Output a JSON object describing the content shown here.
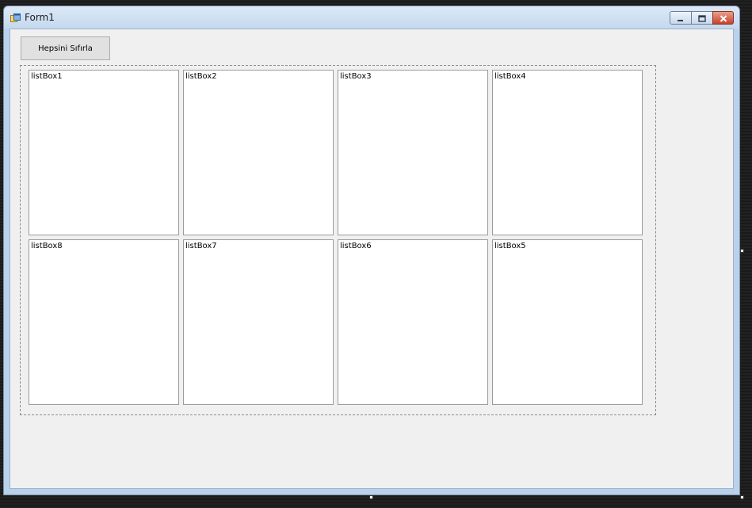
{
  "window": {
    "title": "Form1"
  },
  "toolbar": {
    "reset_label": "Hepsini Sıfırla"
  },
  "listboxes": {
    "row1": [
      "listBox1",
      "listBox2",
      "listBox3",
      "listBox4"
    ],
    "row2": [
      "listBox8",
      "listBox7",
      "listBox6",
      "listBox5"
    ]
  },
  "icons": {
    "app": "form-app-icon",
    "minimize": "minimize-icon",
    "maximize": "maximize-icon",
    "close": "close-icon"
  },
  "colors": {
    "titlebar": "#c4d8ee",
    "client_bg": "#f0f0f0",
    "close_button": "#c7412a"
  }
}
